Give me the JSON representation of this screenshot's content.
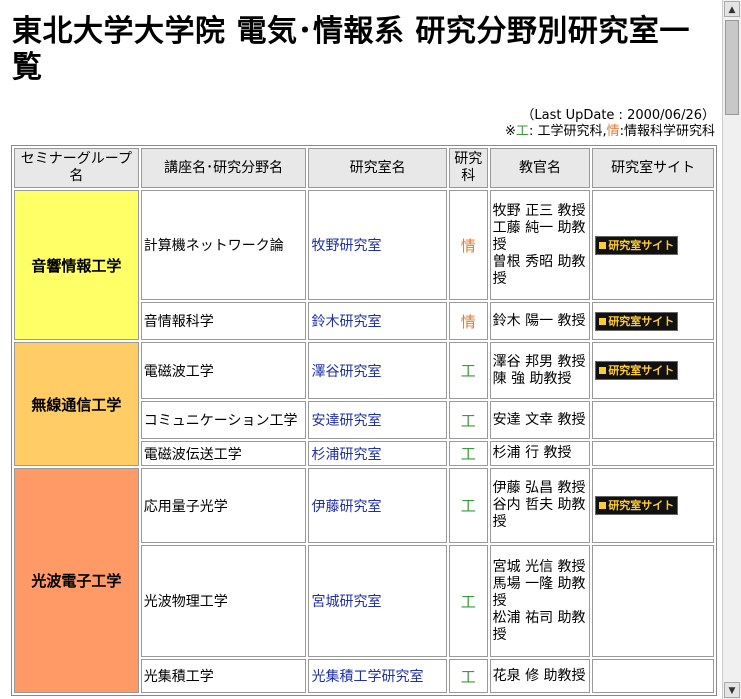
{
  "page": {
    "title": "東北大学大学院 電気･情報系 研究分野別研究室一覧",
    "last_update": "（Last UpDate : 2000/06/26）",
    "legend": {
      "prefix": "※",
      "kou": "工",
      "kou_desc": ": 工学研究科,",
      "jou": "情",
      "jou_desc": ":情報科学研究科"
    }
  },
  "table": {
    "headers": [
      "セミナーグループ名",
      "講座名･研究分野名",
      "研究室名",
      "研究科",
      "教官名",
      "研究室サイト"
    ],
    "site_button_label": "研究室サイト",
    "groups": [
      {
        "name": "音響情報工学",
        "color": "#ffff66",
        "rows": [
          {
            "field": "計算機ネットワーク論",
            "lab": "牧野研究室",
            "dept": "情",
            "profs": [
              "牧野 正三 教授",
              "工藤 純一 助教授",
              "曽根 秀昭 助教授"
            ],
            "site": true
          },
          {
            "field": "音情報科学",
            "lab": "鈴木研究室",
            "dept": "情",
            "profs": [
              "鈴木 陽一 教授"
            ],
            "site": true
          }
        ]
      },
      {
        "name": "無線通信工学",
        "color": "#ffcc66",
        "rows": [
          {
            "field": "電磁波工学",
            "lab": "澤谷研究室",
            "dept": "工",
            "profs": [
              "澤谷 邦男 教授",
              "陳 強 助教授"
            ],
            "site": true
          },
          {
            "field": "コミュニケーション工学",
            "lab": "安達研究室",
            "dept": "工",
            "profs": [
              "安達 文幸 教授"
            ],
            "site": false
          },
          {
            "field": "電磁波伝送工学",
            "lab": "杉浦研究室",
            "dept": "工",
            "profs": [
              "杉浦 行 教授"
            ],
            "site": false
          }
        ]
      },
      {
        "name": "光波電子工学",
        "color": "#ff9966",
        "rows": [
          {
            "field": "応用量子光学",
            "lab": "伊藤研究室",
            "dept": "工",
            "profs": [
              "伊藤 弘昌 教授",
              "谷内 哲夫 助教授"
            ],
            "site": true
          },
          {
            "field": "光波物理工学",
            "lab": "宮城研究室",
            "dept": "工",
            "profs": [
              "宮城 光信 教授",
              "馬場 一隆 助教授",
              "松浦 祐司 助教授"
            ],
            "site": false
          },
          {
            "field": "光集積工学",
            "lab": "光集積工学研究室",
            "dept": "工",
            "profs": [
              "花泉 修 助教授"
            ],
            "site": false
          }
        ]
      }
    ]
  },
  "colors": {
    "kou": "#3a9a3a",
    "jou": "#e07a30",
    "link": "#1f2fa8"
  }
}
